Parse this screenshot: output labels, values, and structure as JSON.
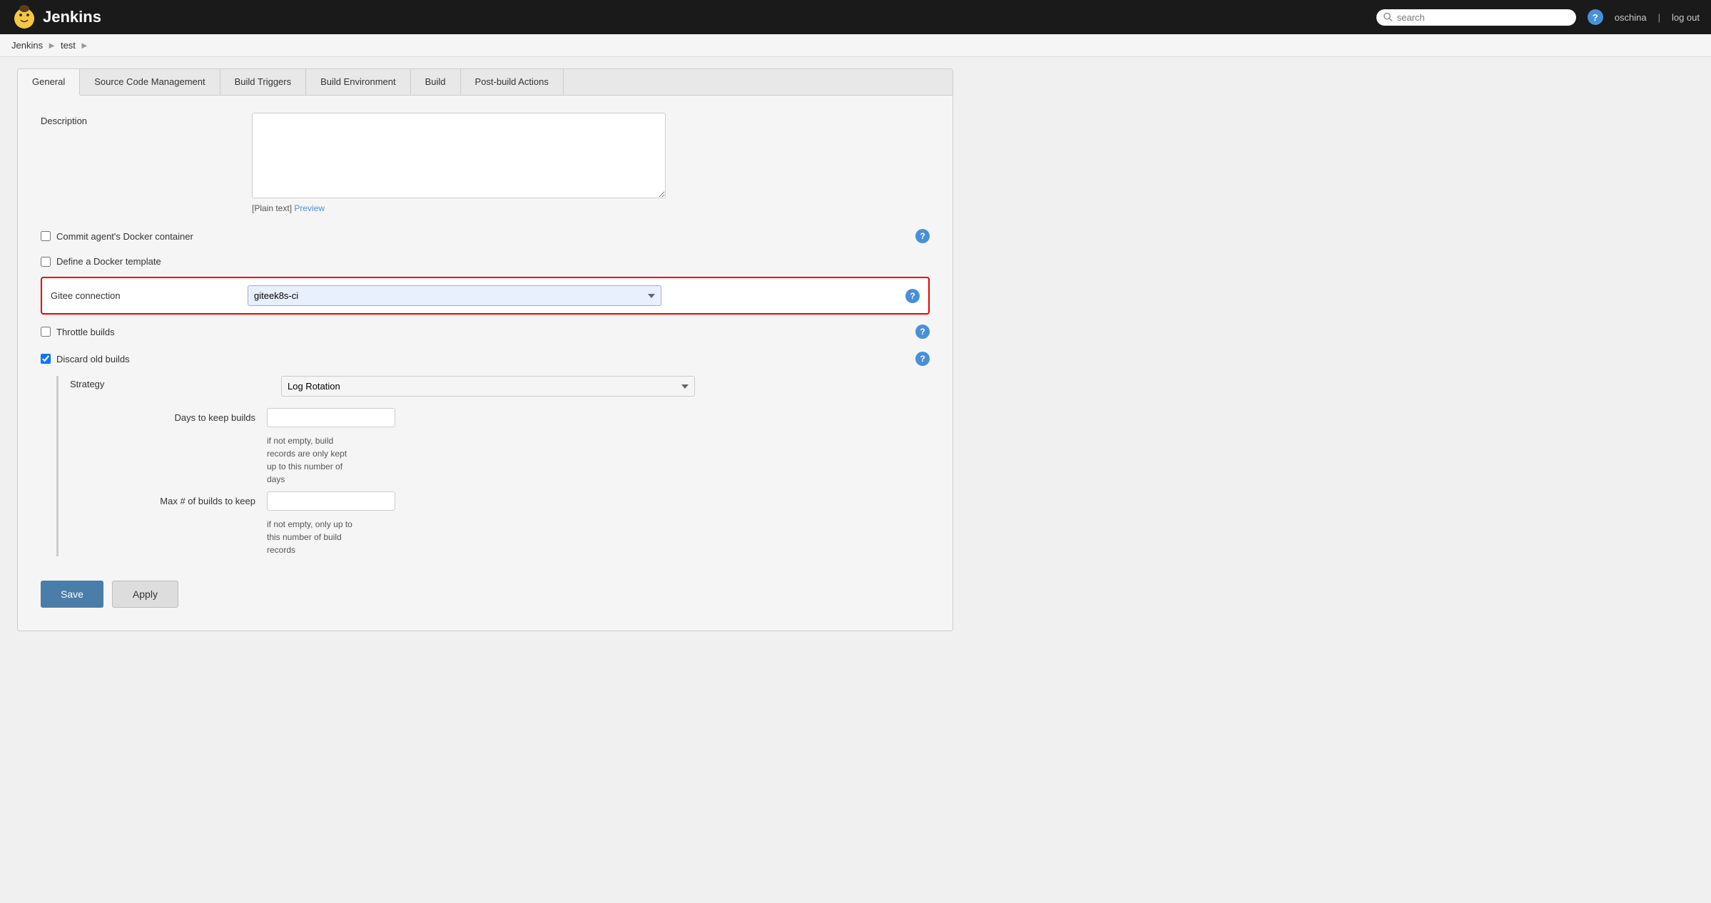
{
  "header": {
    "title": "Jenkins",
    "search_placeholder": "search",
    "user": "oschina",
    "logout": "log out",
    "help_icon": "?"
  },
  "breadcrumb": {
    "items": [
      "Jenkins",
      "test"
    ]
  },
  "tabs": {
    "items": [
      {
        "id": "general",
        "label": "General",
        "active": true
      },
      {
        "id": "source-code",
        "label": "Source Code Management",
        "active": false
      },
      {
        "id": "build-triggers",
        "label": "Build Triggers",
        "active": false
      },
      {
        "id": "build-environment",
        "label": "Build Environment",
        "active": false
      },
      {
        "id": "build",
        "label": "Build",
        "active": false
      },
      {
        "id": "post-build",
        "label": "Post-build Actions",
        "active": false
      }
    ]
  },
  "form": {
    "description_label": "Description",
    "description_value": "",
    "plain_text": "[Plain text]",
    "preview_link": "Preview",
    "checkboxes": [
      {
        "id": "commit-agent",
        "label": "Commit agent's Docker container",
        "checked": false,
        "has_help": true
      },
      {
        "id": "define-docker",
        "label": "Define a Docker template",
        "checked": false,
        "has_help": false
      }
    ],
    "gitee_connection_label": "Gitee connection",
    "gitee_connection_value": "giteek8s-ci",
    "gitee_options": [
      "giteek8s-ci"
    ],
    "throttle_label": "Throttle builds",
    "throttle_checked": false,
    "discard_label": "Discard old builds",
    "discard_checked": true,
    "strategy_label": "Strategy",
    "strategy_value": "Log Rotation",
    "strategy_options": [
      "Log Rotation"
    ],
    "days_label": "Days to keep builds",
    "days_value": "",
    "days_hint": "if not empty, build records are only kept up to this number of days",
    "max_label": "Max # of builds to keep",
    "max_value": "",
    "max_hint": "if not empty, only up to this number of build records",
    "save_label": "Save",
    "apply_label": "Apply"
  }
}
